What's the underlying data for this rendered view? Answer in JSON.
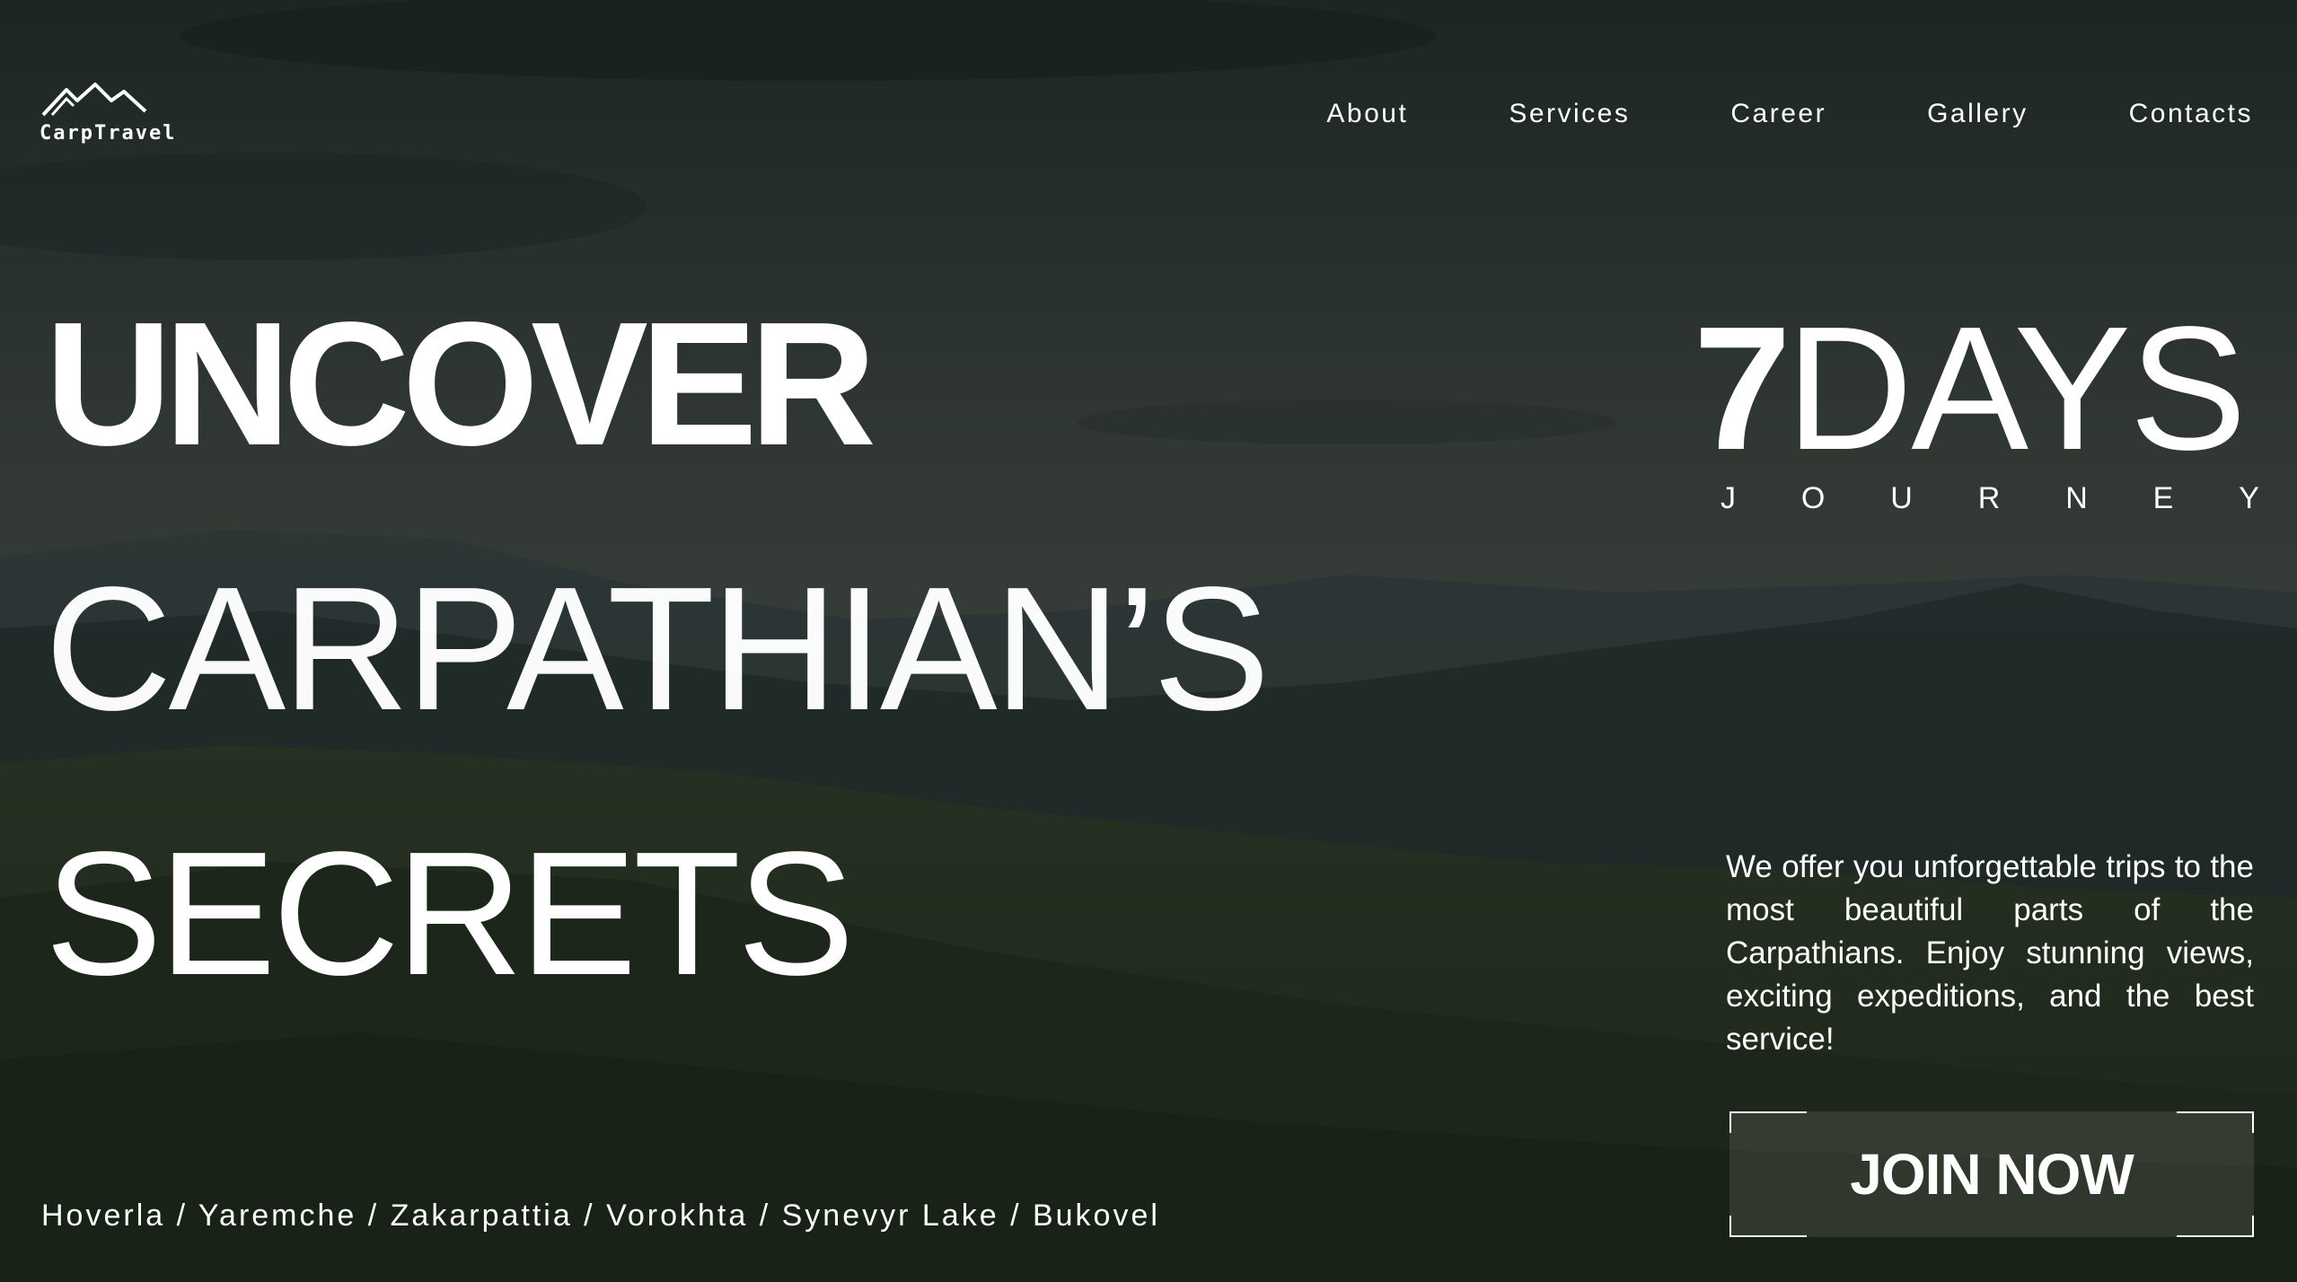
{
  "brand": {
    "logo_text": "CarpTravel",
    "logo_icon": "mountain-logo-icon"
  },
  "nav": {
    "items": [
      {
        "label": "About"
      },
      {
        "label": "Services"
      },
      {
        "label": "Career"
      },
      {
        "label": "Gallery"
      },
      {
        "label": "Contacts"
      }
    ]
  },
  "hero": {
    "line1": "UNCOVER",
    "line2": "CARPATHIAN’S",
    "line3": "SECRETS",
    "days_number": "7",
    "days_word": "DAYS",
    "journey_letters": [
      "J",
      "O",
      "U",
      "R",
      "N",
      "E",
      "Y"
    ],
    "description": "We offer you unforgettable trips to the most beautiful parts of the Carpathians. Enjoy stunning views, exciting expeditions, and the best service!",
    "cta_label": "JOIN NOW",
    "places": "Hoverla / Yaremche / Zakarpattia / Vorokhta / Synevyr Lake / Bukovel"
  },
  "colors": {
    "text": "#ffffff",
    "overlay": "#020f08",
    "sky_top": "#2e3839",
    "hills": "#2a3526"
  }
}
